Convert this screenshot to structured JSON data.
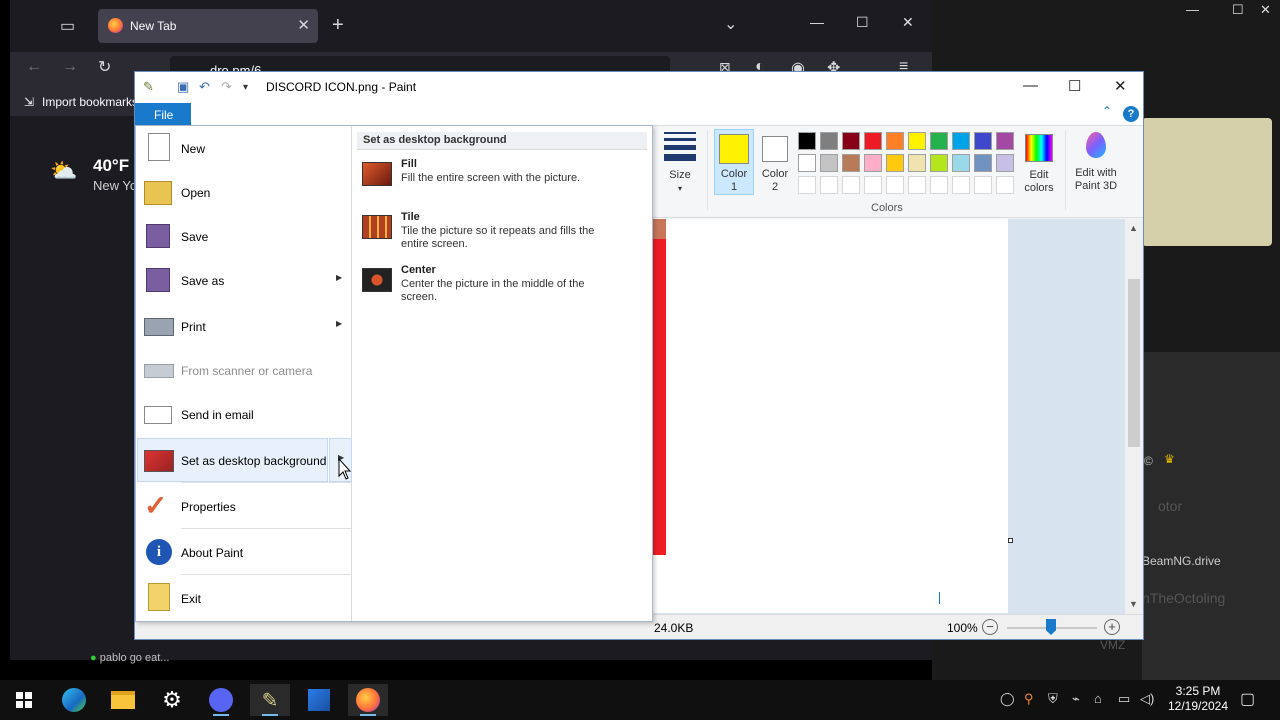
{
  "firefox": {
    "tab_title": "New Tab",
    "url_text": "dro.pm/6",
    "bookmark_label": "Import bookmarks...",
    "weather_temp": "40°F",
    "weather_location": "New York",
    "feed_text": "pablo go eat..."
  },
  "right_app": {
    "line1": "©",
    "line2": "otor",
    "line3": "BeamNG.drive",
    "line4": "nTheOctoling",
    "line5": "VMZ"
  },
  "paint": {
    "title": "DISCORD ICON.png - Paint",
    "file_tab": "File",
    "ribbon": {
      "size_label": "Size",
      "color1_label": "Color\n1",
      "color2_label": "Color\n2",
      "edit_colors_label": "Edit\ncolors",
      "edit_paint3d_label": "Edit with\nPaint 3D",
      "colors_group_label": "Colors",
      "color1_value": "#fff200",
      "color2_value": "#ffffff",
      "palette_row1": [
        "#000000",
        "#7f7f7f",
        "#880015",
        "#ed1c24",
        "#ff7f27",
        "#fff200",
        "#22b14c",
        "#00a2e8",
        "#3f48cc",
        "#a349a4"
      ],
      "palette_row2": [
        "#ffffff",
        "#c3c3c3",
        "#b97a57",
        "#ffaec9",
        "#ffc90e",
        "#efe4b0",
        "#b5e61d",
        "#99d9ea",
        "#7092be",
        "#c8bfe7"
      ]
    },
    "status": {
      "size": "24.0KB",
      "zoom": "100%"
    }
  },
  "file_menu": {
    "items": [
      {
        "label": "New"
      },
      {
        "label": "Open"
      },
      {
        "label": "Save"
      },
      {
        "label": "Save as"
      },
      {
        "label": "Print"
      },
      {
        "label": "From scanner or camera"
      },
      {
        "label": "Send in email"
      },
      {
        "label": "Set as desktop background"
      },
      {
        "label": "Properties"
      },
      {
        "label": "About Paint"
      },
      {
        "label": "Exit"
      }
    ],
    "submenu": {
      "header": "Set as desktop background",
      "options": [
        {
          "title": "Fill",
          "desc": "Fill the entire screen with the picture."
        },
        {
          "title": "Tile",
          "desc": "Tile the picture so it repeats and fills the entire screen."
        },
        {
          "title": "Center",
          "desc": "Center the picture in the middle of the screen."
        }
      ]
    }
  },
  "taskbar": {
    "time": "3:25 PM",
    "date": "12/19/2024"
  }
}
